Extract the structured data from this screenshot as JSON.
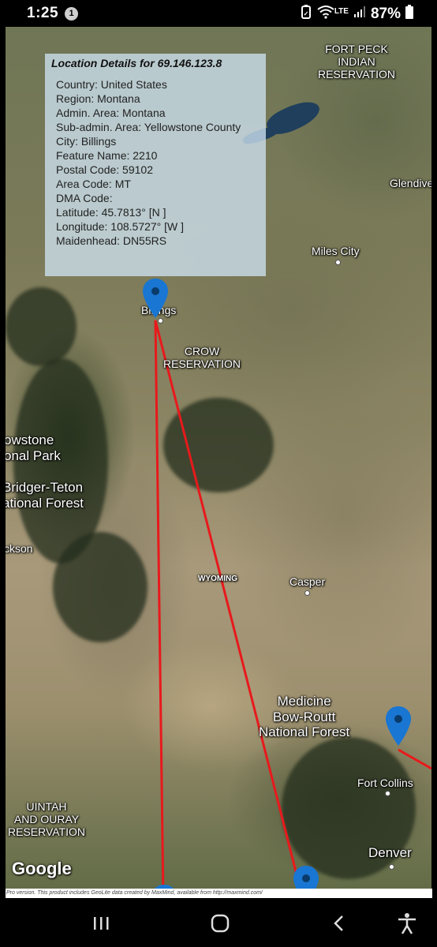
{
  "status": {
    "time": "1:25",
    "notification_count": "1",
    "network": "LTE",
    "battery": "87%"
  },
  "info_box": {
    "title": "Location Details for 69.146.123.8",
    "rows": [
      "Country: United States",
      "Region: Montana",
      "Admin. Area: Montana",
      "Sub-admin. Area: Yellowstone County",
      "City: Billings",
      "Feature Name: 2210",
      "Postal Code: 59102",
      "Area Code: MT",
      "DMA Code:",
      "Latitude: 45.7813° [N ]",
      "Longitude: 108.5727° [W ]",
      "Maidenhead: DN55RS"
    ]
  },
  "map_labels": {
    "fort_peck": "FORT PECK\nINDIAN\nRESERVATION",
    "glendive": "Glendive",
    "miles_city": "Miles City",
    "billings": "Billings",
    "crow": "CROW\nRESERVATION",
    "yellowstone": "owstone\nonal Park",
    "bridger": "Bridger-Teton\national Forest",
    "jackson": "ckson",
    "wyoming": "WYOMING",
    "casper": "Casper",
    "medicine_bow": "Medicine\nBow-Routt\nNational Forest",
    "fort_collins": "Fort Collins",
    "uintah": "UINTAH\nAND OURAY\nRESERVATION",
    "denver": "Denver"
  },
  "google_logo": "Google",
  "footer_text": "Pro version. This product includes GeoLite data created by MaxMind, available from http://maxmind.com/",
  "colors": {
    "route": "#e8191c",
    "marker": "#1976d2",
    "info_bg": "#cde2f0"
  }
}
